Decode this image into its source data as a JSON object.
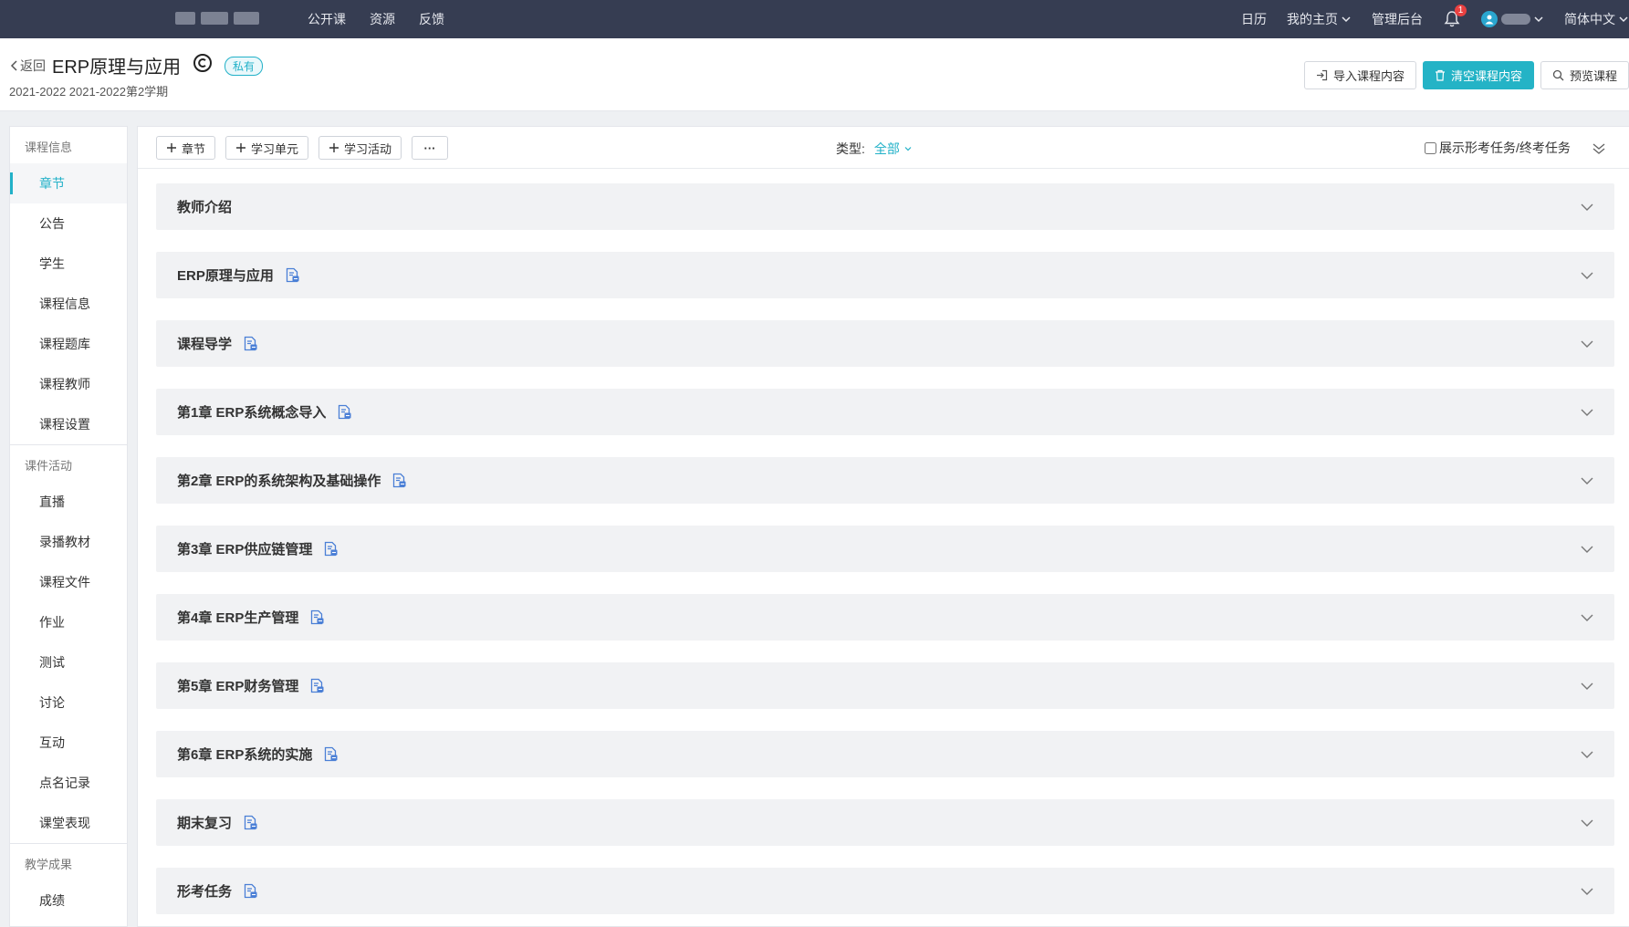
{
  "nav": {
    "links": [
      "公开课",
      "资源",
      "反馈"
    ],
    "calendar": "日历",
    "my_home": "我的主页",
    "admin": "管理后台",
    "notification_count": "1",
    "language": "简体中文"
  },
  "header": {
    "back_label": "返回",
    "title": "ERP原理与应用",
    "privacy_badge": "私有",
    "term": "2021-2022 2021-2022第2学期",
    "import_button": "导入课程内容",
    "clear_button": "清空课程内容",
    "preview_button": "预览课程"
  },
  "sidebar": {
    "groups": [
      {
        "title": "课程信息",
        "items": [
          "章节",
          "公告",
          "学生",
          "课程信息",
          "课程题库",
          "课程教师",
          "课程设置"
        ]
      },
      {
        "title": "课件活动",
        "items": [
          "直播",
          "录播教材",
          "课程文件",
          "作业",
          "测试",
          "讨论",
          "互动",
          "点名记录",
          "课堂表现"
        ]
      },
      {
        "title": "教学成果",
        "items": [
          "成绩"
        ]
      }
    ],
    "active_item": "章节"
  },
  "toolbar": {
    "add_chapter": "章节",
    "add_unit": "学习单元",
    "add_activity": "学习活动",
    "more": "···",
    "type_label": "类型:",
    "type_value": "全部",
    "show_tasks_label": "展示形考任务/终考任务"
  },
  "chapters": [
    {
      "title": "教师介绍",
      "has_doc_icon": false
    },
    {
      "title": "ERP原理与应用",
      "has_doc_icon": true
    },
    {
      "title": "课程导学",
      "has_doc_icon": true
    },
    {
      "title": "第1章 ERP系统概念导入",
      "has_doc_icon": true
    },
    {
      "title": "第2章 ERP的系统架构及基础操作",
      "has_doc_icon": true
    },
    {
      "title": "第3章 ERP供应链管理",
      "has_doc_icon": true
    },
    {
      "title": "第4章 ERP生产管理",
      "has_doc_icon": true
    },
    {
      "title": "第5章 ERP财务管理",
      "has_doc_icon": true
    },
    {
      "title": "第6章 ERP系统的实施",
      "has_doc_icon": true
    },
    {
      "title": "期末复习",
      "has_doc_icon": true
    },
    {
      "title": "形考任务",
      "has_doc_icon": true
    }
  ],
  "colors": {
    "nav_bg": "#363d52",
    "accent": "#22b1c8",
    "doc_icon": "#4a7fd6"
  }
}
